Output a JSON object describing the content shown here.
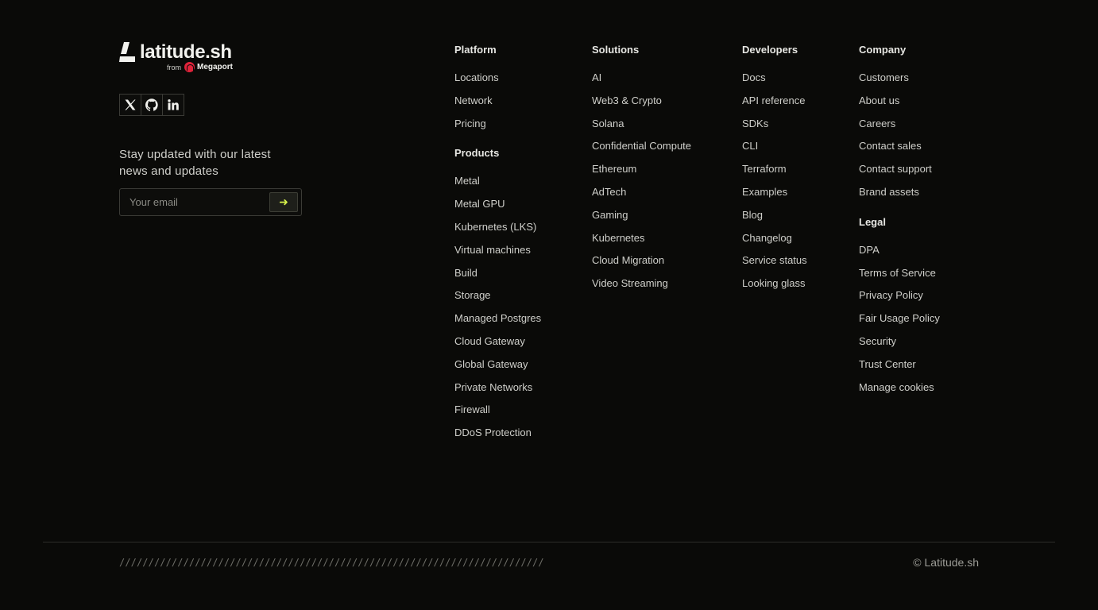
{
  "brand": {
    "name": "latitude.sh",
    "from_label": "from",
    "parent_name": "Megaport",
    "social": [
      {
        "icon": "x-twitter-icon"
      },
      {
        "icon": "github-icon"
      },
      {
        "icon": "linkedin-icon"
      }
    ],
    "newsletter_text": "Stay updated with our latest news and updates",
    "email_placeholder": "Your email",
    "submit_icon": "arrow-right-icon",
    "accent_color": "#d5f04a"
  },
  "columns": {
    "platform": {
      "heading": "Platform",
      "items": [
        "Locations",
        "Network",
        "Pricing"
      ],
      "sub_heading": "Products",
      "sub_items": [
        "Metal",
        "Metal GPU",
        "Kubernetes (LKS)",
        "Virtual machines",
        "Build",
        "Storage",
        "Managed Postgres",
        "Cloud Gateway",
        "Global Gateway",
        "Private Networks",
        "Firewall",
        "DDoS Protection"
      ]
    },
    "solutions": {
      "heading": "Solutions",
      "items": [
        "AI",
        "Web3 & Crypto",
        "Solana",
        "Confidential Compute",
        "Ethereum",
        "AdTech",
        "Gaming",
        "Kubernetes",
        "Cloud Migration",
        "Video Streaming"
      ]
    },
    "developers": {
      "heading": "Developers",
      "items": [
        "Docs",
        "API reference",
        "SDKs",
        "CLI",
        "Terraform",
        "Examples",
        "Blog",
        "Changelog",
        "Service status",
        "Looking glass"
      ]
    },
    "company": {
      "heading": "Company",
      "items": [
        "Customers",
        "About us",
        "Careers",
        "Contact sales",
        "Contact support",
        "Brand assets"
      ],
      "sub_heading": "Legal",
      "sub_items": [
        "DPA",
        "Terms of Service",
        "Privacy Policy",
        "Fair Usage Policy",
        "Security",
        "Trust Center",
        "Manage cookies"
      ]
    }
  },
  "footer": {
    "slashes": "/////////////////////////////////////////////////////////////////////////",
    "copyright": "© Latitude.sh"
  }
}
